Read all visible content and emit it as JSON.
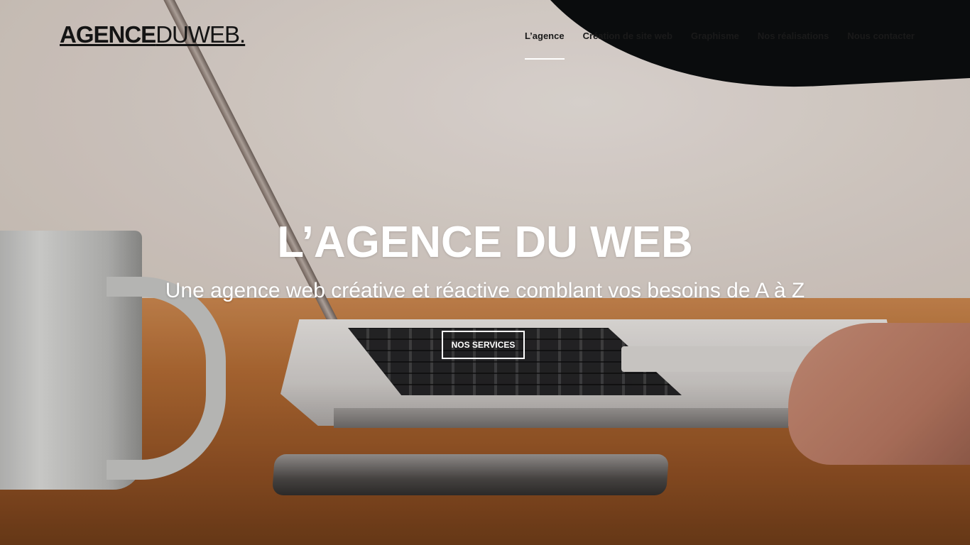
{
  "brand": {
    "logo_bold": "AGENCE",
    "logo_light": "DUWEB."
  },
  "nav": {
    "items": [
      {
        "label": "L’agence",
        "active": true
      },
      {
        "label": "Création de site web",
        "active": false
      },
      {
        "label": "Graphisme",
        "active": false
      },
      {
        "label": "Nos réalisations",
        "active": false
      },
      {
        "label": "Nous contacter",
        "active": false
      }
    ]
  },
  "hero": {
    "title": "L’AGENCE DU WEB",
    "subtitle": "Une agence web créative et réactive comblant vos besoins de A à Z",
    "cta_label": "NOS SERVICES"
  },
  "colors": {
    "nav_text": "#1a1a1a",
    "hero_text": "#ffffff",
    "active_underline": "#ffffff"
  }
}
